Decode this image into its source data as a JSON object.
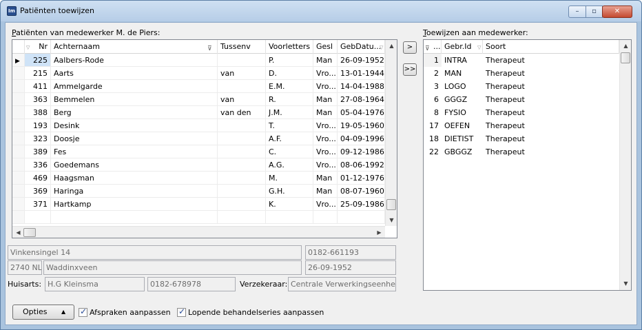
{
  "window": {
    "app_icon": "Im",
    "title": "Patiënten toewijzen",
    "controls": {
      "minimize": "–",
      "maximize": "▫",
      "close": "✕"
    }
  },
  "left_panel": {
    "label_prefix": "P",
    "label_rest": "atiënten van medewerker M. de Piers:",
    "columns": [
      "Nr",
      "Achternaam",
      "Tussenv",
      "Voorletters",
      "Gesl",
      "GebDatu..."
    ],
    "rows": [
      {
        "nr": "225",
        "achternaam": "Aalbers-Rode",
        "tussenv": "",
        "voorletters": "P.",
        "gesl": "Man",
        "gebdatum": "26-09-1952"
      },
      {
        "nr": "215",
        "achternaam": "Aarts",
        "tussenv": "van",
        "voorletters": "D.",
        "gesl": "Vro...",
        "gebdatum": "13-01-1944"
      },
      {
        "nr": "411",
        "achternaam": "Ammelgarde",
        "tussenv": "",
        "voorletters": "E.M.",
        "gesl": "Vro...",
        "gebdatum": "14-04-1988"
      },
      {
        "nr": "363",
        "achternaam": "Bemmelen",
        "tussenv": "van",
        "voorletters": "R.",
        "gesl": "Man",
        "gebdatum": "27-08-1964"
      },
      {
        "nr": "388",
        "achternaam": "Berg",
        "tussenv": "van den",
        "voorletters": "J.M.",
        "gesl": "Man",
        "gebdatum": "05-04-1976"
      },
      {
        "nr": "193",
        "achternaam": "Desink",
        "tussenv": "",
        "voorletters": "T.",
        "gesl": "Vro...",
        "gebdatum": "19-05-1960"
      },
      {
        "nr": "323",
        "achternaam": "Doosje",
        "tussenv": "",
        "voorletters": "A.F.",
        "gesl": "Vro...",
        "gebdatum": "04-09-1996"
      },
      {
        "nr": "389",
        "achternaam": "Fes",
        "tussenv": "",
        "voorletters": "C.",
        "gesl": "Vro...",
        "gebdatum": "09-12-1986"
      },
      {
        "nr": "336",
        "achternaam": "Goedemans",
        "tussenv": "",
        "voorletters": "A.G.",
        "gesl": "Vro...",
        "gebdatum": "08-06-1992"
      },
      {
        "nr": "469",
        "achternaam": "Haagsman",
        "tussenv": "",
        "voorletters": "M.",
        "gesl": "Man",
        "gebdatum": "01-12-1976"
      },
      {
        "nr": "369",
        "achternaam": "Haringa",
        "tussenv": "",
        "voorletters": "G.H.",
        "gesl": "Man",
        "gebdatum": "08-07-1960"
      },
      {
        "nr": "371",
        "achternaam": "Hartkamp",
        "tussenv": "",
        "voorletters": "K.",
        "gesl": "Vro...",
        "gebdatum": "25-09-1986"
      }
    ]
  },
  "transfer_buttons": {
    "single": ">",
    "all": ">>"
  },
  "right_panel": {
    "label_prefix": "T",
    "label_rest": "oewijzen aan medewerker:",
    "columns": [
      "...",
      "Gebr.Id",
      "Soort"
    ],
    "rows": [
      {
        "nr": "1",
        "gebr_id": "INTRA",
        "soort": "Therapeut"
      },
      {
        "nr": "2",
        "gebr_id": "MAN",
        "soort": "Therapeut"
      },
      {
        "nr": "3",
        "gebr_id": "LOGO",
        "soort": "Therapeut"
      },
      {
        "nr": "6",
        "gebr_id": "GGGZ",
        "soort": "Therapeut"
      },
      {
        "nr": "8",
        "gebr_id": "FYSIO",
        "soort": "Therapeut"
      },
      {
        "nr": "17",
        "gebr_id": "OEFEN",
        "soort": "Therapeut"
      },
      {
        "nr": "18",
        "gebr_id": "DIETIST",
        "soort": "Therapeut"
      },
      {
        "nr": "22",
        "gebr_id": "GBGGZ",
        "soort": "Therapeut"
      }
    ]
  },
  "details": {
    "address": "Vinkensingel 14",
    "phone": "0182-661193",
    "postcode": "2740 NL",
    "city": "Waddinxveen",
    "birthdate": "26-09-1952",
    "huisarts_label": "Huisarts:",
    "huisarts": "H.G Kleinsma",
    "huisarts_phone": "0182-678978",
    "verzekeraar_label": "Verzekeraar:",
    "verzekeraar": "Centrale Verwerkingseenhei..."
  },
  "footer": {
    "options_label": "Opties",
    "options_arrow": "▲",
    "check_afspraken": "Afspraken aanpassen",
    "check_behandel": "Lopende behandelseries aanpassen",
    "check_afspraken_checked": true,
    "check_behandel_checked": true
  },
  "icons": {
    "row_pointer": "▶",
    "sort": "▽",
    "filter": "⊽",
    "scroll_up": "▲",
    "scroll_down": "▼",
    "scroll_left": "◀",
    "scroll_right": "▶",
    "checkmark": "✓"
  }
}
